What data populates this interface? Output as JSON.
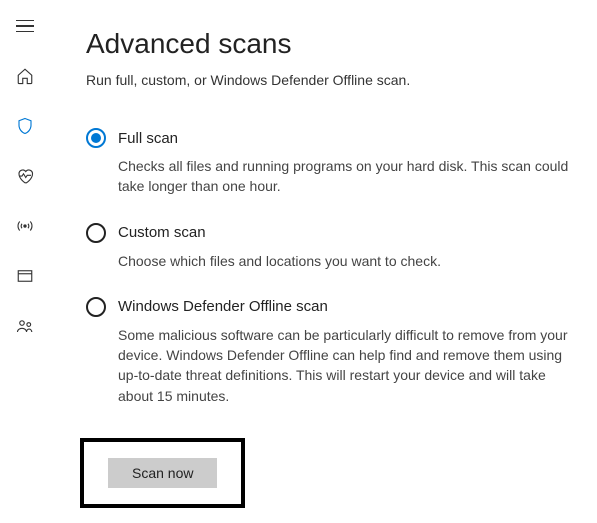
{
  "sidebar": {
    "items": [
      {
        "name": "hamburger-icon"
      },
      {
        "name": "home-icon"
      },
      {
        "name": "shield-icon"
      },
      {
        "name": "heart-icon"
      },
      {
        "name": "antenna-icon"
      },
      {
        "name": "window-icon"
      },
      {
        "name": "people-icon"
      }
    ]
  },
  "page": {
    "title": "Advanced scans",
    "subtitle": "Run full, custom, or Windows Defender Offline scan."
  },
  "options": [
    {
      "label": "Full scan",
      "description": "Checks all files and running programs on your hard disk. This scan could take longer than one hour.",
      "selected": true
    },
    {
      "label": "Custom scan",
      "description": "Choose which files and locations you want to check.",
      "selected": false
    },
    {
      "label": "Windows Defender Offline scan",
      "description": "Some malicious software can be particularly difficult to remove from your device. Windows Defender Offline can help find and remove them using up-to-date threat definitions. This will restart your device and will take about 15 minutes.",
      "selected": false
    }
  ],
  "actions": {
    "scan_button": "Scan now"
  }
}
